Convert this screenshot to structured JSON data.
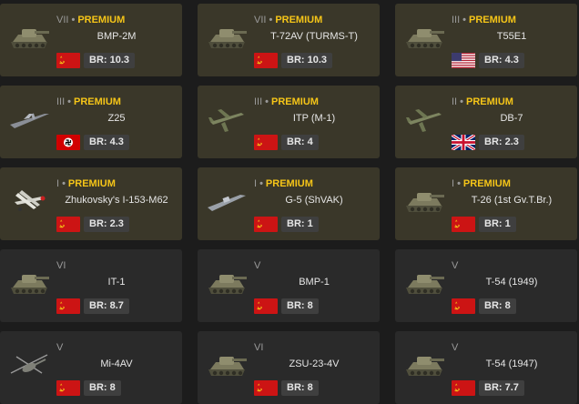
{
  "premium_label": "PREMIUM",
  "colors": {
    "premium": "#f5c518",
    "premium_card": "#3a3729",
    "regular_card": "#2a2a2a"
  },
  "vehicles": [
    {
      "rank": "VII",
      "premium": true,
      "name": "BMP-2M",
      "br": "BR: 10.3",
      "nation": "ussr-flag",
      "type": "tank-icon"
    },
    {
      "rank": "VII",
      "premium": true,
      "name": "T-72AV (TURMS-T)",
      "br": "BR: 10.3",
      "nation": "ussr-flag",
      "type": "tank-icon"
    },
    {
      "rank": "III",
      "premium": true,
      "name": "T55E1",
      "br": "BR: 4.3",
      "nation": "usa-flag",
      "type": "tank-icon"
    },
    {
      "rank": "III",
      "premium": true,
      "name": "Z25",
      "br": "BR: 4.3",
      "nation": "germany-flag",
      "type": "ship-icon"
    },
    {
      "rank": "III",
      "premium": true,
      "name": "ITP (M-1)",
      "br": "BR: 4",
      "nation": "ussr-flag",
      "type": "plane-icon"
    },
    {
      "rank": "II",
      "premium": true,
      "name": "DB-7",
      "br": "BR: 2.3",
      "nation": "uk-flag",
      "type": "plane-icon"
    },
    {
      "rank": "I",
      "premium": true,
      "name": "Zhukovsky's I-153-M62",
      "br": "BR: 2.3",
      "nation": "ussr-flag",
      "type": "biplane-icon"
    },
    {
      "rank": "I",
      "premium": true,
      "name": "G-5 (ShVAK)",
      "br": "BR: 1",
      "nation": "ussr-flag",
      "type": "boat-icon"
    },
    {
      "rank": "I",
      "premium": true,
      "name": "T-26 (1st Gv.T.Br.)",
      "br": "BR: 1",
      "nation": "ussr-flag",
      "type": "tank-icon"
    },
    {
      "rank": "VI",
      "premium": false,
      "name": "IT-1",
      "br": "BR: 8.7",
      "nation": "ussr-flag",
      "type": "tank-icon"
    },
    {
      "rank": "V",
      "premium": false,
      "name": "BMP-1",
      "br": "BR: 8",
      "nation": "ussr-flag",
      "type": "tank-icon"
    },
    {
      "rank": "V",
      "premium": false,
      "name": "T-54 (1949)",
      "br": "BR: 8",
      "nation": "ussr-flag",
      "type": "tank-icon"
    },
    {
      "rank": "V",
      "premium": false,
      "name": "Mi-4AV",
      "br": "BR: 8",
      "nation": "ussr-flag",
      "type": "helicopter-icon"
    },
    {
      "rank": "VI",
      "premium": false,
      "name": "ZSU-23-4V",
      "br": "BR: 8",
      "nation": "ussr-flag",
      "type": "tank-icon"
    },
    {
      "rank": "V",
      "premium": false,
      "name": "T-54 (1947)",
      "br": "BR: 7.7",
      "nation": "ussr-flag",
      "type": "tank-icon"
    }
  ]
}
